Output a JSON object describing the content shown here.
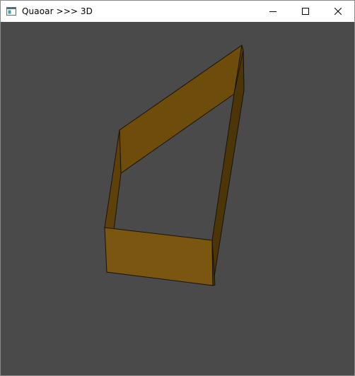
{
  "window": {
    "title": "Quaoar >>> 3D",
    "buttons": {
      "minimize": "minimize",
      "maximize": "maximize",
      "close": "close"
    }
  },
  "icons": {
    "app": "app-window-icon",
    "minimize": "minimize-icon",
    "maximize": "maximize-icon",
    "close": "close-icon"
  },
  "colors": {
    "viewport_background": "#4a4a4a",
    "face_light": "#7b5610",
    "face_dark": "#5e4108",
    "face_darker": "#4c3506",
    "edge": "#1a1208"
  }
}
